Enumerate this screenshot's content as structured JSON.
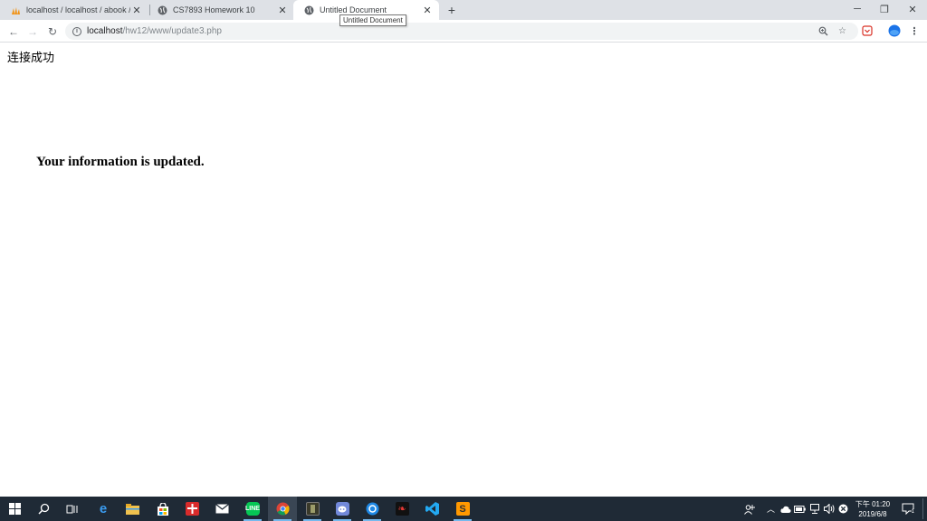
{
  "tabs": [
    {
      "title": "localhost / localhost / abook / a"
    },
    {
      "title": "CS7893 Homework 10"
    },
    {
      "title": "Untitled Document"
    }
  ],
  "tooltip": "Untitled Document",
  "omnibox": {
    "host": "localhost",
    "path": "/hw12/www/update3.php"
  },
  "page": {
    "connection_message": "连接成功",
    "update_message": "Your information is updated."
  },
  "taskbar": {
    "clock_time": "下午 01:20",
    "clock_date": "2019/6/8",
    "notification_count": "1"
  },
  "colors": {
    "tabstrip_bg": "#dee1e6",
    "taskbar_bg": "#1f2a36",
    "accent": "#1a73e8"
  }
}
